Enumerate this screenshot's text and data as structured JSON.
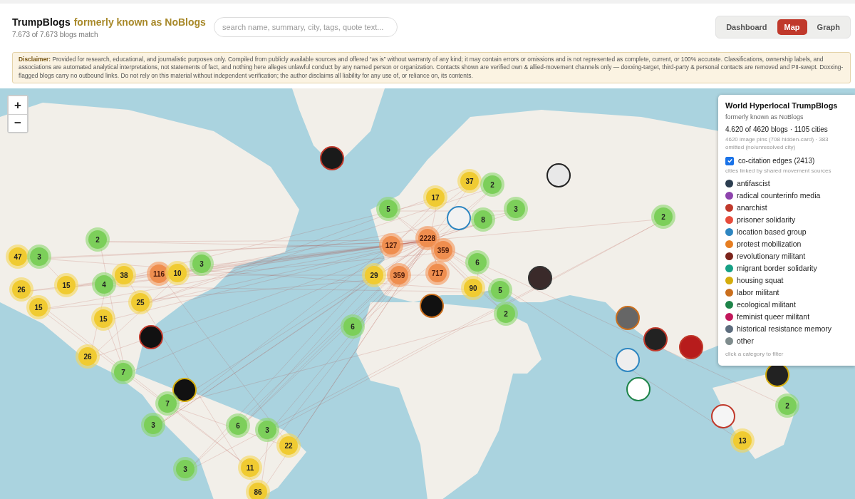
{
  "header": {
    "title": "TrumpBlogs",
    "subtitle": "formerly known as NoBlogs",
    "match_count": "7.673 of 7.673 blogs match"
  },
  "search": {
    "placeholder": "search name, summary, city, tags, quote text..."
  },
  "tabs": [
    {
      "label": "Dashboard",
      "selected": false
    },
    {
      "label": "Map",
      "selected": true
    },
    {
      "label": "Graph",
      "selected": false
    }
  ],
  "disclaimer": "**Disclaimer:** Provided for research, educational, and journalistic purposes only. Compiled from publicly available sources and offered “as is” without warranty of any kind; it may contain errors or omissions and is not represented as complete, current, or 100% accurate. Classifications, ownership labels, and associations are automated analytical interpretations, not statements of fact, and nothing here alleges unlawful conduct by any named person or organization. Contacts shown are verified own & allied-movement channels only — doxxing-target, third-party & personal contacts are removed and PII-swept. Doxxing-flagged blogs carry no outbound links. Do not rely on this material without independent verification; the author disclaims all liability for any use of, or reliance on, its contents.",
  "map": {
    "zoom_in": "+",
    "zoom_out": "−",
    "clusters": [
      {
        "count": "47",
        "kind": "medium"
      },
      {
        "count": "3",
        "kind": "small"
      },
      {
        "count": "2",
        "kind": "small"
      },
      {
        "count": "38",
        "kind": "medium"
      },
      {
        "count": "116",
        "kind": "large"
      },
      {
        "count": "10",
        "kind": "medium"
      },
      {
        "count": "3",
        "kind": "small"
      },
      {
        "count": "15",
        "kind": "medium"
      },
      {
        "count": "4",
        "kind": "small"
      },
      {
        "count": "26",
        "kind": "medium"
      },
      {
        "count": "25",
        "kind": "medium"
      },
      {
        "count": "15",
        "kind": "medium"
      },
      {
        "count": "15",
        "kind": "medium"
      },
      {
        "count": "26",
        "kind": "medium"
      },
      {
        "count": "7",
        "kind": "small"
      },
      {
        "count": "7",
        "kind": "small"
      },
      {
        "count": "3",
        "kind": "small"
      },
      {
        "count": "6",
        "kind": "small"
      },
      {
        "count": "3",
        "kind": "small"
      },
      {
        "count": "22",
        "kind": "medium"
      },
      {
        "count": "11",
        "kind": "medium"
      },
      {
        "count": "86",
        "kind": "medium"
      },
      {
        "count": "3",
        "kind": "small"
      },
      {
        "count": "6",
        "kind": "small"
      },
      {
        "count": "5",
        "kind": "small"
      },
      {
        "count": "17",
        "kind": "medium"
      },
      {
        "count": "37",
        "kind": "medium"
      },
      {
        "count": "2",
        "kind": "small"
      },
      {
        "count": "3",
        "kind": "small"
      },
      {
        "count": "8",
        "kind": "small"
      },
      {
        "count": "2228",
        "kind": "large"
      },
      {
        "count": "127",
        "kind": "large"
      },
      {
        "count": "359",
        "kind": "large"
      },
      {
        "count": "29",
        "kind": "medium"
      },
      {
        "count": "359",
        "kind": "large"
      },
      {
        "count": "717",
        "kind": "large"
      },
      {
        "count": "6",
        "kind": "small"
      },
      {
        "count": "90",
        "kind": "medium"
      },
      {
        "count": "5",
        "kind": "small"
      },
      {
        "count": "2",
        "kind": "small"
      },
      {
        "count": "2",
        "kind": "small"
      },
      {
        "count": "2",
        "kind": "small"
      },
      {
        "count": "13",
        "kind": "medium"
      }
    ]
  },
  "legend": {
    "title": "World Hyperlocal TrumpBlogs",
    "subtitle": "formerly known as NoBlogs",
    "stats": "4.620 of 4620 blogs · 1105 cities",
    "note": "4620 image pins (708 hidden-card) · 383 omitted (no/unresolved city)",
    "edges": {
      "label": "co-citation edges (2413)",
      "checked": true,
      "hint": "cities linked by shared movement sources"
    },
    "categories": [
      {
        "label": "antifascist",
        "color": "#2c3e50"
      },
      {
        "label": "radical counterinfo media",
        "color": "#8e44ad"
      },
      {
        "label": "anarchist",
        "color": "#c0392b"
      },
      {
        "label": "prisoner solidarity",
        "color": "#e74c3c"
      },
      {
        "label": "location based group",
        "color": "#2e86c1"
      },
      {
        "label": "protest mobilization",
        "color": "#e67e22"
      },
      {
        "label": "revolutionary militant",
        "color": "#7b241c"
      },
      {
        "label": "migrant border solidarity",
        "color": "#16a085"
      },
      {
        "label": "housing squat",
        "color": "#d4ac0d"
      },
      {
        "label": "labor militant",
        "color": "#ca6f1e"
      },
      {
        "label": "ecological militant",
        "color": "#1e8449"
      },
      {
        "label": "feminist queer militant",
        "color": "#c2185b"
      },
      {
        "label": "historical resistance memory",
        "color": "#5d6d7e"
      },
      {
        "label": "other",
        "color": "#7f8c8d"
      }
    ],
    "footer": "click a category to filter"
  }
}
